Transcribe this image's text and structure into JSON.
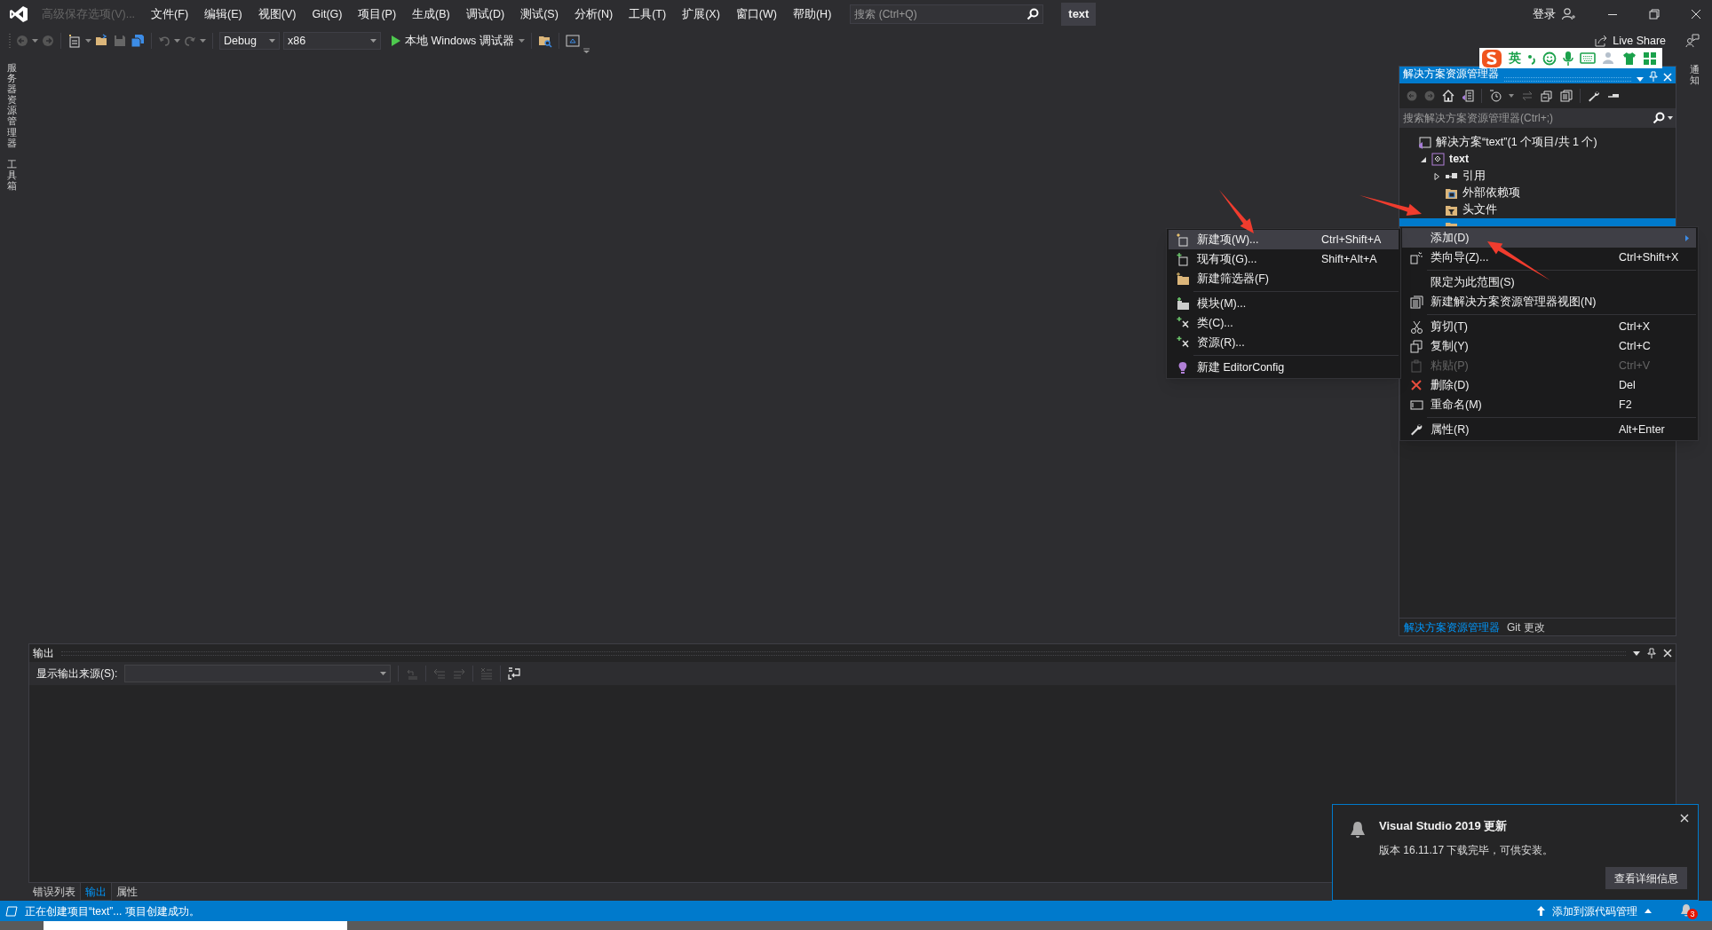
{
  "title_bar": {
    "menus": [
      {
        "label": "高级保存选项(V)...",
        "disabled": true
      },
      {
        "label": "文件(F)",
        "disabled": false
      },
      {
        "label": "编辑(E)",
        "disabled": false
      },
      {
        "label": "视图(V)",
        "disabled": false
      },
      {
        "label": "Git(G)",
        "disabled": false
      },
      {
        "label": "项目(P)",
        "disabled": false
      },
      {
        "label": "生成(B)",
        "disabled": false
      },
      {
        "label": "调试(D)",
        "disabled": false
      },
      {
        "label": "测试(S)",
        "disabled": false
      },
      {
        "label": "分析(N)",
        "disabled": false
      },
      {
        "label": "工具(T)",
        "disabled": false
      },
      {
        "label": "扩展(X)",
        "disabled": false
      },
      {
        "label": "窗口(W)",
        "disabled": false
      },
      {
        "label": "帮助(H)",
        "disabled": false
      }
    ],
    "search": {
      "placeholder": "搜索 (Ctrl+Q)"
    },
    "solution_name": "text",
    "sign_in": "登录"
  },
  "toolbar": {
    "configuration": "Debug",
    "platform": "x86",
    "run_label": "本地 Windows 调试器",
    "live_share": "Live Share"
  },
  "left_side_tabs": [
    "服务器资源管理器",
    "工具箱"
  ],
  "right_side_tabs": [
    "通知"
  ],
  "ime_bar": {
    "mode": "英"
  },
  "solution_explorer": {
    "title": "解决方案资源管理器",
    "search": {
      "placeholder": "搜索解决方案资源管理器(Ctrl+;)"
    },
    "tree": [
      {
        "kind": "solution",
        "label": "解决方案“text”(1 个项目/共 1 个)",
        "selected": false,
        "children": [
          {
            "kind": "project",
            "label": "text",
            "selected": false,
            "expanded": true,
            "children": [
              {
                "kind": "references",
                "label": "引用",
                "selected": false,
                "expanded": false
              },
              {
                "kind": "external",
                "label": "外部依赖项",
                "selected": false
              },
              {
                "kind": "filter",
                "label": "头文件",
                "selected": false
              },
              {
                "kind": "filter",
                "selected": true
              }
            ]
          }
        ]
      }
    ],
    "tabs": [
      {
        "label": "解决方案资源管理器",
        "selected": true
      },
      {
        "label": "Git 更改",
        "selected": false
      }
    ]
  },
  "context_menu": [
    {
      "kind": "item",
      "label": "添加(D)",
      "submenu": true,
      "selected": true,
      "disabled": false
    },
    {
      "kind": "item",
      "label": "类向导(Z)...",
      "shortcut": "Ctrl+Shift+X",
      "submenu": false,
      "selected": false,
      "disabled": false
    },
    {
      "kind": "separator"
    },
    {
      "kind": "item",
      "label": "限定为此范围(S)",
      "submenu": false,
      "selected": false,
      "disabled": false
    },
    {
      "kind": "item",
      "label": "新建解决方案资源管理器视图(N)",
      "submenu": false,
      "selected": false,
      "disabled": false
    },
    {
      "kind": "separator"
    },
    {
      "kind": "item",
      "label": "剪切(T)",
      "shortcut": "Ctrl+X",
      "submenu": false,
      "selected": false,
      "disabled": false
    },
    {
      "kind": "item",
      "label": "复制(Y)",
      "shortcut": "Ctrl+C",
      "submenu": false,
      "selected": false,
      "disabled": false
    },
    {
      "kind": "item",
      "label": "粘贴(P)",
      "shortcut": "Ctrl+V",
      "submenu": false,
      "selected": false,
      "disabled": true
    },
    {
      "kind": "item",
      "label": "删除(D)",
      "shortcut": "Del",
      "submenu": false,
      "selected": false,
      "disabled": false
    },
    {
      "kind": "item",
      "label": "重命名(M)",
      "shortcut": "F2",
      "submenu": false,
      "selected": false,
      "disabled": false
    },
    {
      "kind": "separator"
    },
    {
      "kind": "item",
      "label": "属性(R)",
      "shortcut": "Alt+Enter",
      "submenu": false,
      "selected": false,
      "disabled": false
    }
  ],
  "submenu": [
    {
      "kind": "item",
      "label": "新建项(W)...",
      "shortcut": "Ctrl+Shift+A",
      "selected": true
    },
    {
      "kind": "item",
      "label": "现有项(G)...",
      "shortcut": "Shift+Alt+A",
      "selected": false
    },
    {
      "kind": "item",
      "label": "新建筛选器(F)",
      "selected": false
    },
    {
      "kind": "separator"
    },
    {
      "kind": "item",
      "label": "模块(M)...",
      "selected": false
    },
    {
      "kind": "item",
      "label": "类(C)...",
      "selected": false
    },
    {
      "kind": "item",
      "label": "资源(R)...",
      "selected": false
    },
    {
      "kind": "separator"
    },
    {
      "kind": "item",
      "label": "新建 EditorConfig",
      "selected": false
    }
  ],
  "output": {
    "title": "输出",
    "source_label": "显示输出来源(S):",
    "tabs": [
      {
        "label": "错误列表",
        "selected": false
      },
      {
        "label": "输出",
        "selected": true
      },
      {
        "label": "属性",
        "selected": false
      }
    ]
  },
  "notification": {
    "title": "Visual Studio 2019 更新",
    "body": "版本 16.11.17 下载完毕，可供安装。",
    "button": "查看详细信息"
  },
  "status_bar": {
    "message": "正在创建项目“text”... 项目创建成功。",
    "source_control": "添加到源代码管理",
    "notification_count": "3"
  }
}
